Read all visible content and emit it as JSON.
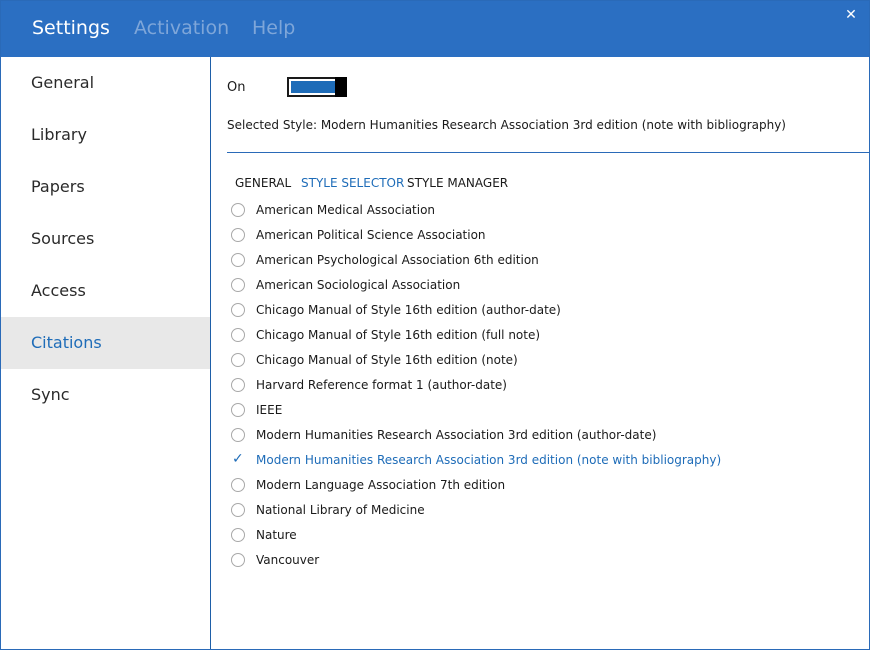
{
  "header": {
    "tabs": [
      {
        "label": "Settings",
        "active": true
      },
      {
        "label": "Activation",
        "active": false
      },
      {
        "label": "Help",
        "active": false
      }
    ],
    "close_glyph": "✕"
  },
  "sidebar": {
    "items": [
      {
        "label": "General",
        "active": false
      },
      {
        "label": "Library",
        "active": false
      },
      {
        "label": "Papers",
        "active": false
      },
      {
        "label": "Sources",
        "active": false
      },
      {
        "label": "Access",
        "active": false
      },
      {
        "label": "Citations",
        "active": true
      },
      {
        "label": "Sync",
        "active": false
      }
    ]
  },
  "citations": {
    "toggle_label": "On",
    "toggle_on": true,
    "selected_style_text": "Selected Style: Modern Humanities Research Association 3rd edition (note with bibliography)",
    "subtabs": [
      {
        "label": "GENERAL",
        "active": false
      },
      {
        "label": "STYLE SELECTOR",
        "active": true
      },
      {
        "label": "STYLE MANAGER",
        "active": false
      }
    ],
    "styles": [
      {
        "label": "American Medical Association",
        "selected": false
      },
      {
        "label": "American Political Science Association",
        "selected": false
      },
      {
        "label": "American Psychological Association 6th edition",
        "selected": false
      },
      {
        "label": "American Sociological Association",
        "selected": false
      },
      {
        "label": "Chicago Manual of Style 16th edition (author-date)",
        "selected": false
      },
      {
        "label": "Chicago Manual of Style 16th edition (full note)",
        "selected": false
      },
      {
        "label": "Chicago Manual of Style 16th edition (note)",
        "selected": false
      },
      {
        "label": "Harvard Reference format 1 (author-date)",
        "selected": false
      },
      {
        "label": "IEEE",
        "selected": false
      },
      {
        "label": "Modern Humanities Research Association 3rd edition (author-date)",
        "selected": false
      },
      {
        "label": "Modern Humanities Research Association 3rd edition (note with bibliography)",
        "selected": true
      },
      {
        "label": "Modern Language Association 7th edition",
        "selected": false
      },
      {
        "label": "National Library of Medicine",
        "selected": false
      },
      {
        "label": "Nature",
        "selected": false
      },
      {
        "label": "Vancouver",
        "selected": false
      }
    ],
    "check_glyph": "✓"
  },
  "colors": {
    "accent": "#1e6cb8",
    "titlebar": "#2b6fc2",
    "sidebar_active_bg": "#e8e8e8"
  }
}
